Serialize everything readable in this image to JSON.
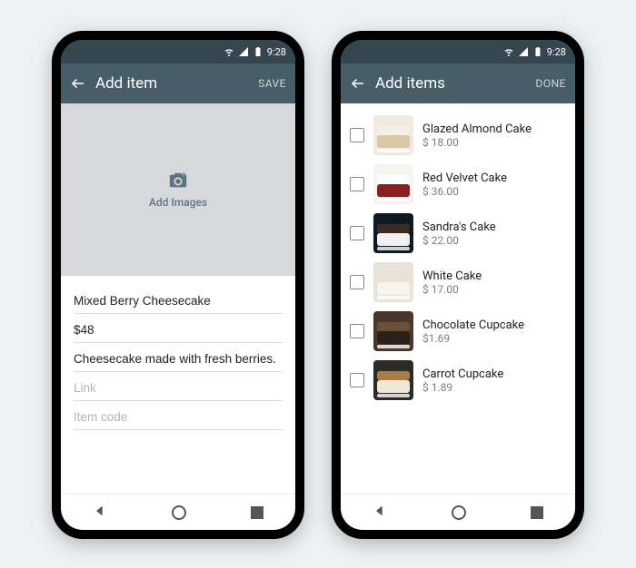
{
  "status": {
    "time": "9:28"
  },
  "left": {
    "title": "Add item",
    "action": "SAVE",
    "add_images": "Add Images",
    "fields": {
      "name": "Mixed Berry Cheesecake",
      "price": "$48",
      "desc": "Cheesecake made with fresh berries.",
      "link_ph": "Link",
      "code_ph": "Item code"
    }
  },
  "right": {
    "title": "Add items",
    "action": "DONE",
    "items": [
      {
        "name": "Glazed Almond Cake",
        "price": "$ 18.00",
        "bg": "#efe9df",
        "a": "#d9c8a8",
        "b": "#f5f0e5"
      },
      {
        "name": "Red Velvet Cake",
        "price": "$ 36.00",
        "bg": "#f7f3ee",
        "a": "#8a1f1f",
        "b": "#ffffff"
      },
      {
        "name": "Sandra's Cake",
        "price": "$ 22.00",
        "bg": "#0d1a22",
        "a": "#f0f0f0",
        "b": "#3b2b22"
      },
      {
        "name": "White Cake",
        "price": "$ 17.00",
        "bg": "#e7e3d8",
        "a": "#f7f4ec",
        "b": "#e9e3d5"
      },
      {
        "name": "Chocolate Cupcake",
        "price": "$1.69",
        "bg": "#4a372c",
        "a": "#2e2018",
        "b": "#6b4f3a"
      },
      {
        "name": "Carrot Cupcake",
        "price": "$ 1.89",
        "bg": "#2b2b28",
        "a": "#efe7d4",
        "b": "#a87c47"
      }
    ]
  }
}
